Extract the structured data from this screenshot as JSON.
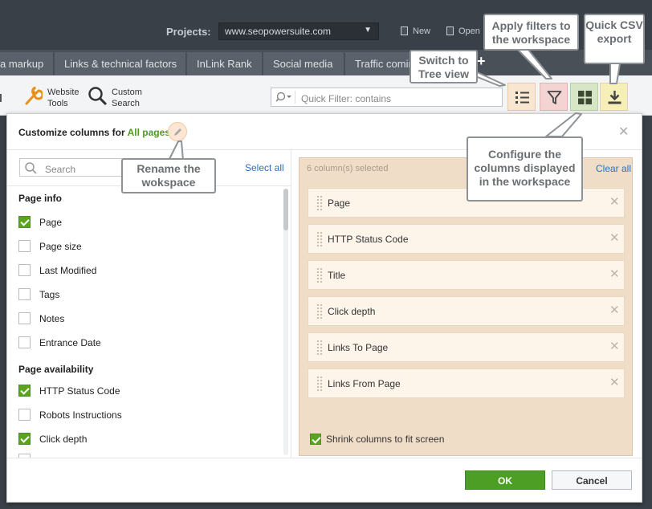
{
  "app": {
    "projects_label": "Projects:",
    "project_url": "www.seopowersuite.com",
    "new_label": "New",
    "open_label": "Open"
  },
  "tabs": [
    {
      "label": "a markup"
    },
    {
      "label": "Links & technical factors"
    },
    {
      "label": "InLink Rank"
    },
    {
      "label": "Social media"
    },
    {
      "label": "Traffic comin"
    }
  ],
  "toolbar": {
    "website_tools": "Website Tools",
    "custom_search": "Custom Search",
    "quick_filter_placeholder": "Quick Filter: contains"
  },
  "dialog": {
    "title_prefix": "Customize columns for ",
    "workspace_name": "All pages",
    "search_placeholder": "Search",
    "select_all": "Select all",
    "selected_count": "6 column(s) selected",
    "clear_all": "Clear all",
    "groups": [
      {
        "label": "Page info",
        "items": [
          {
            "label": "Page",
            "checked": true
          },
          {
            "label": "Page size",
            "checked": false
          },
          {
            "label": "Last Modified",
            "checked": false
          },
          {
            "label": "Tags",
            "checked": false
          },
          {
            "label": "Notes",
            "checked": false
          },
          {
            "label": "Entrance Date",
            "checked": false
          }
        ]
      },
      {
        "label": "Page availability",
        "items": [
          {
            "label": "HTTP Status Code",
            "checked": true
          },
          {
            "label": "Robots Instructions",
            "checked": false
          },
          {
            "label": "Click depth",
            "checked": true
          }
        ]
      }
    ],
    "selected_columns": [
      {
        "label": "Page"
      },
      {
        "label": "HTTP Status Code"
      },
      {
        "label": "Title"
      },
      {
        "label": "Click depth"
      },
      {
        "label": "Links To Page"
      },
      {
        "label": "Links From Page"
      }
    ],
    "shrink_label": "Shrink columns to fit screen",
    "shrink_checked": true,
    "ok_label": "OK",
    "cancel_label": "Cancel"
  },
  "callouts": {
    "apply_filters": "Apply filters to the workspace",
    "quick_csv": "Quick CSV export",
    "switch_tree": "Switch to Tree view",
    "configure_columns": "Configure the columns displayed in the workspace",
    "rename_workspace": "Rename the wokspace"
  },
  "colors": {
    "accent_green": "#4c9e25",
    "link_blue": "#2d6fbf",
    "panel_beige": "#f0ddc7"
  }
}
